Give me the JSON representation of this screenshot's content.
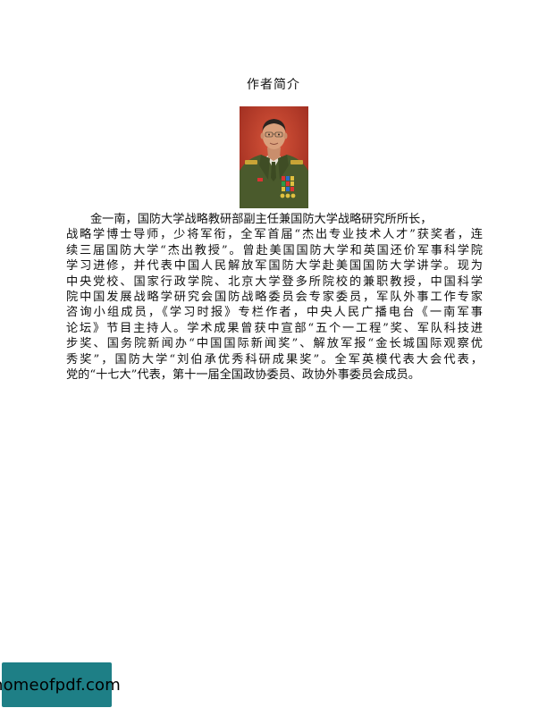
{
  "heading": "作者简介",
  "portrait": {
    "description_icon": "author-portrait-photo",
    "colors": {
      "background": "#b83a2a",
      "uniform": "#4a5a2c",
      "skin": "#d9a07c"
    }
  },
  "bio_lines": [
    "金一南，国防大学战略教研部副主任兼国防大学战略研究所所长，",
    "战略学博士导师，少将军衔，全军首届“杰出专业技术人才”获奖者，连",
    "续三届国防大学“杰出教授”。曾赴美国国防大学和英国还价军事科学院",
    "学习进修，并代表中国人民解放军国防大学赴美国国防大学讲学。现为",
    "中央党校、国家行政学院、北京大学登多所院校的兼职教授，中国科学",
    "院中国发展战略学研究会国防战略委员会专家委员，军队外事工作专家",
    "咨询小组成员，《学习时报》专栏作者，中央人民广播电台《一南军事",
    "论坛》节目主持人。学术成果曾获中宣部“五个一工程”奖、军队科技进",
    "步奖、国务院新闻办“中国国际新闻奖”、解放军报“金长城国际观察优",
    "秀奖”，国防大学“刘伯承优秀科研成果奖”。全军英模代表大会代表，",
    "党的“十七大”代表，第十一届全国政协委员、政协外事委员会成员。"
  ],
  "watermark": {
    "text": "homeofpdf.com",
    "color": "#1e7f86"
  }
}
